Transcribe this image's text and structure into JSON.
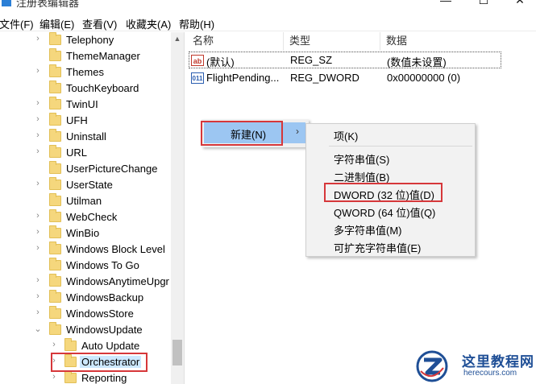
{
  "window": {
    "title": "注册表编辑器",
    "buttons": {
      "minimize": "—",
      "maximize": "☐",
      "close": "✕"
    }
  },
  "menubar": [
    "文件(F)",
    "编辑(E)",
    "查看(V)",
    "收藏夹(A)",
    "帮助(H)"
  ],
  "tree": {
    "items": [
      {
        "label": "Telephony",
        "expander": "›"
      },
      {
        "label": "ThemeManager",
        "expander": ""
      },
      {
        "label": "Themes",
        "expander": "›"
      },
      {
        "label": "TouchKeyboard",
        "expander": ""
      },
      {
        "label": "TwinUI",
        "expander": "›"
      },
      {
        "label": "UFH",
        "expander": "›"
      },
      {
        "label": "Uninstall",
        "expander": "›"
      },
      {
        "label": "URL",
        "expander": "›"
      },
      {
        "label": "UserPictureChange",
        "expander": ""
      },
      {
        "label": "UserState",
        "expander": "›"
      },
      {
        "label": "Utilman",
        "expander": ""
      },
      {
        "label": "WebCheck",
        "expander": "›"
      },
      {
        "label": "WinBio",
        "expander": "›"
      },
      {
        "label": "Windows Block Level",
        "expander": "›"
      },
      {
        "label": "Windows To Go",
        "expander": ""
      },
      {
        "label": "WindowsAnytimeUpgr",
        "expander": "›"
      },
      {
        "label": "WindowsBackup",
        "expander": "›"
      },
      {
        "label": "WindowsStore",
        "expander": "›"
      },
      {
        "label": "WindowsUpdate",
        "expander": "⌄"
      },
      {
        "label": "Auto Update",
        "expander": "›"
      },
      {
        "label": "Orchestrator",
        "expander": "›"
      },
      {
        "label": "Reporting",
        "expander": "›"
      }
    ]
  },
  "values_pane": {
    "columns": {
      "name": "名称",
      "type": "类型",
      "data": "数据"
    },
    "rows": [
      {
        "icon": "ab",
        "name": "(默认)",
        "type": "REG_SZ",
        "data": "(数值未设置)"
      },
      {
        "icon": "011",
        "name": "FlightPending...",
        "type": "REG_DWORD",
        "data": "0x00000000 (0)"
      }
    ]
  },
  "context_menu": {
    "new_label": "新建(N)",
    "arrow": "›",
    "submenu": [
      "项(K)",
      "字符串值(S)",
      "二进制值(B)",
      "DWORD (32 位)值(D)",
      "QWORD (64 位)值(Q)",
      "多字符串值(M)",
      "可扩充字符串值(E)"
    ]
  },
  "watermark": {
    "cn": "这里教程网",
    "en": "herecours.com"
  },
  "colors": {
    "highlight_red": "#d6373a",
    "menu_hover": "#9cc6f2",
    "folder": "#f5d77d",
    "watermark_blue": "#1f4f96"
  }
}
